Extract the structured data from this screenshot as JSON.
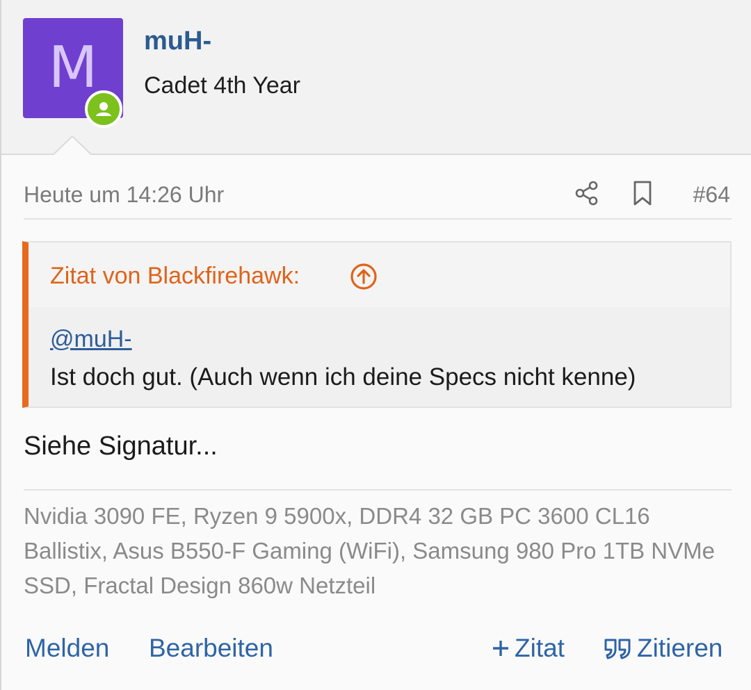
{
  "user": {
    "avatar_letter": "M",
    "avatar_color": "#6f3fcf",
    "online_badge_color": "#7cc11c",
    "name": "muH-",
    "title": "Cadet 4th Year"
  },
  "meta": {
    "date": "Heute um 14:26 Uhr",
    "share_icon": "share-icon",
    "bookmark_icon": "bookmark-icon",
    "post_number": "#64"
  },
  "quote": {
    "accent_color": "#e8691c",
    "author": "Zitat von Blackfirehawk:",
    "jump_icon": "arrow-up-circle-icon",
    "mention": "@muH-",
    "text": "Ist doch gut. (Auch wenn ich deine Specs nicht kenne)"
  },
  "body": {
    "text": "Siehe Signatur..."
  },
  "signature": {
    "text": "Nvidia 3090 FE, Ryzen 9 5900x, DDR4 32 GB PC 3600 CL16 Ballistix, Asus B550-F Gaming (WiFi), Samsung 980 Pro 1TB NVMe SSD, Fractal Design 860w Netzteil"
  },
  "actions": {
    "report": "Melden",
    "edit": "Bearbeiten",
    "multiquote": "Zitat",
    "quote": "Zitieren",
    "link_color": "#2e64a6"
  }
}
